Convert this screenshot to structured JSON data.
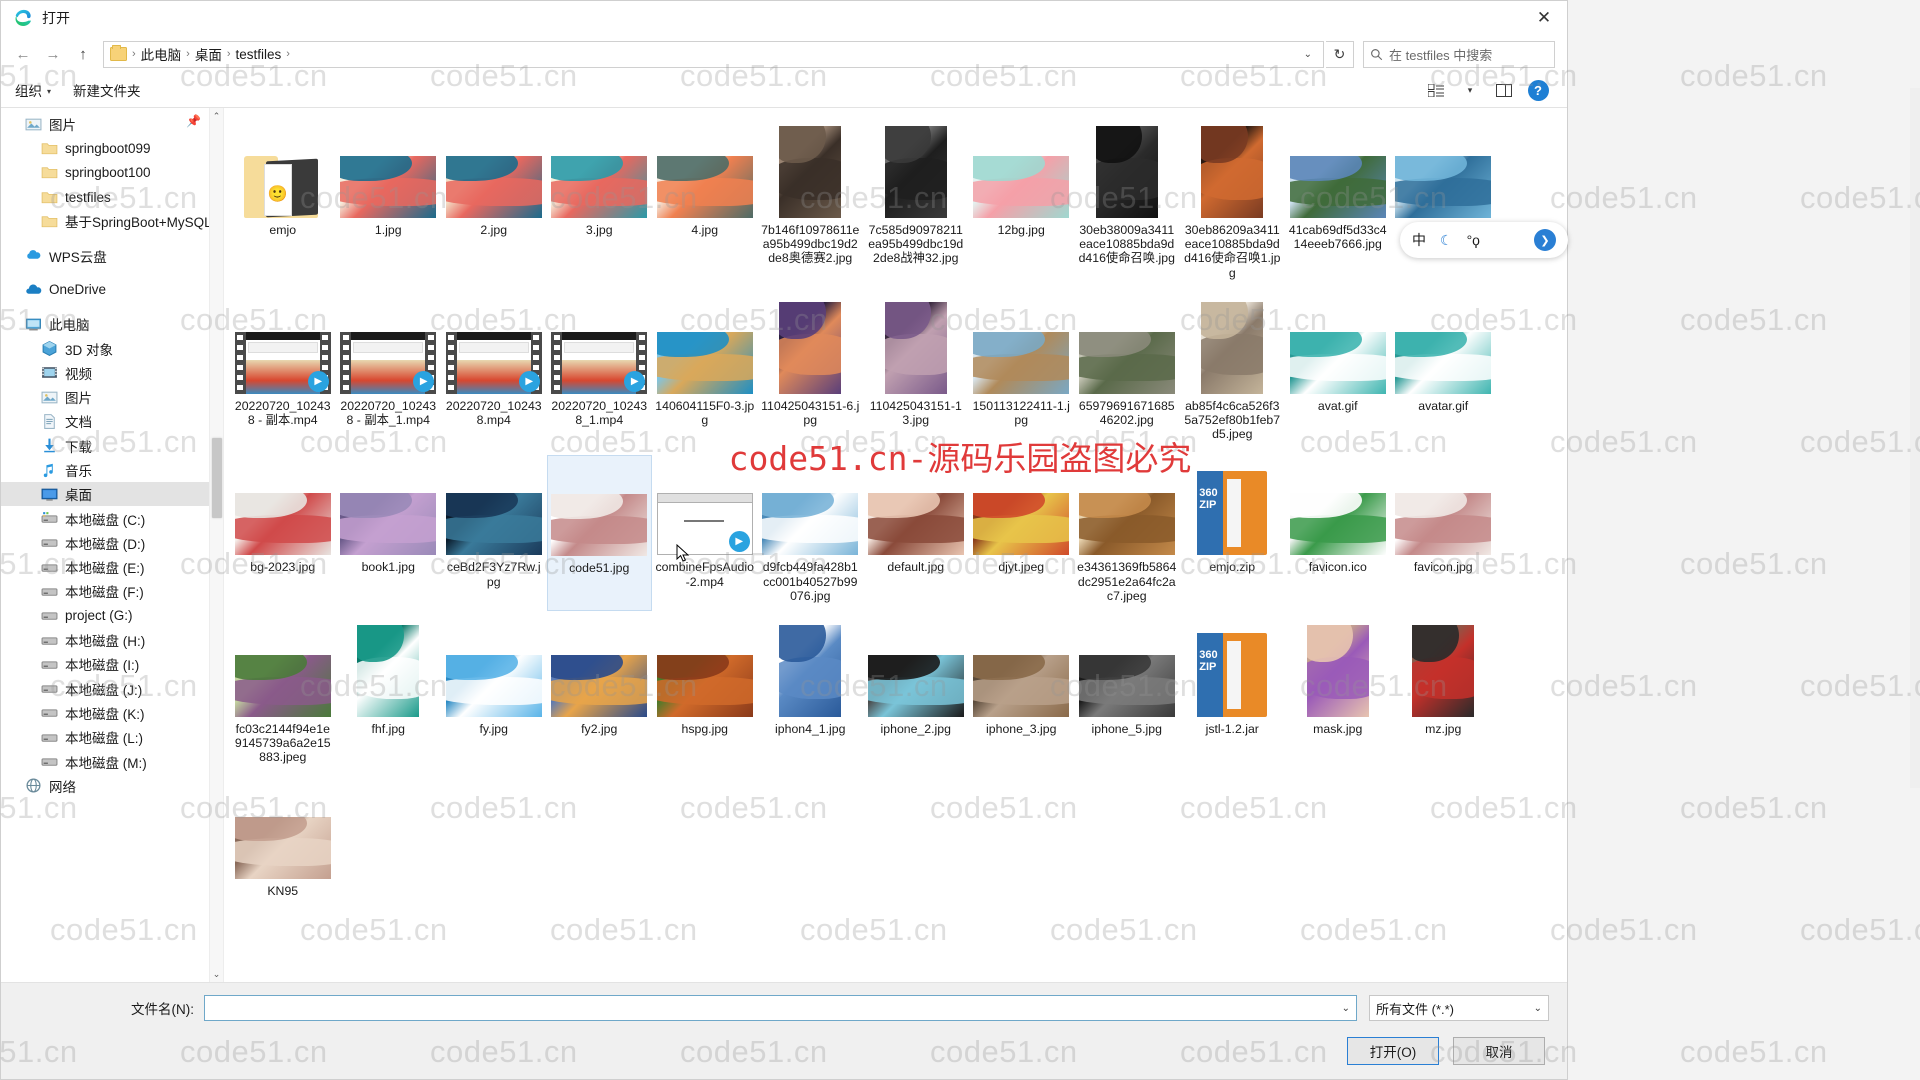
{
  "window": {
    "title": "打开",
    "app_icon": "edge-icon",
    "close_label": "✕"
  },
  "nav": {
    "back": "←",
    "forward": "→",
    "up": "↑",
    "refresh": "↻",
    "address_chevron": "⌄",
    "breadcrumbs": [
      "此电脑",
      "桌面",
      "testfiles"
    ],
    "separator": "›"
  },
  "search": {
    "placeholder": "在 testfiles 中搜索",
    "icon": "search-icon"
  },
  "command_bar": {
    "organize": "组织",
    "organize_caret": "▾",
    "new_folder": "新建文件夹",
    "view_icon": "view-list-icon",
    "view_caret": "▾",
    "pane_icon": "preview-pane-icon",
    "help_icon": "?"
  },
  "sidebar": {
    "pin_icon": "pin-icon",
    "scroll_up": "⌃",
    "scroll_down": "⌄",
    "items": [
      {
        "label": "图片",
        "icon": "pictures-icon",
        "indent": 0,
        "selected": false
      },
      {
        "label": "springboot099",
        "icon": "folder-icon",
        "indent": 1,
        "selected": false
      },
      {
        "label": "springboot100",
        "icon": "folder-icon",
        "indent": 1,
        "selected": false
      },
      {
        "label": "testfiles",
        "icon": "folder-icon",
        "indent": 1,
        "selected": false
      },
      {
        "label": "基于SpringBoot+MySQL+Vue",
        "icon": "folder-icon",
        "indent": 1,
        "selected": false
      },
      {
        "label": "WPS云盘",
        "icon": "cloud-icon",
        "indent": 0,
        "selected": false,
        "spacer_before": true
      },
      {
        "label": "OneDrive",
        "icon": "onedrive-icon",
        "indent": 0,
        "selected": false,
        "spacer_before": true
      },
      {
        "label": "此电脑",
        "icon": "pc-icon",
        "indent": 0,
        "selected": false,
        "spacer_before": true
      },
      {
        "label": "3D 对象",
        "icon": "3dobjects-icon",
        "indent": 1,
        "selected": false
      },
      {
        "label": "视频",
        "icon": "videos-icon",
        "indent": 1,
        "selected": false
      },
      {
        "label": "图片",
        "icon": "pictures-icon",
        "indent": 1,
        "selected": false
      },
      {
        "label": "文档",
        "icon": "documents-icon",
        "indent": 1,
        "selected": false
      },
      {
        "label": "下载",
        "icon": "downloads-icon",
        "indent": 1,
        "selected": false
      },
      {
        "label": "音乐",
        "icon": "music-icon",
        "indent": 1,
        "selected": false
      },
      {
        "label": "桌面",
        "icon": "desktop-icon",
        "indent": 1,
        "selected": true
      },
      {
        "label": "本地磁盘 (C:)",
        "icon": "drive-system-icon",
        "indent": 1,
        "selected": false
      },
      {
        "label": "本地磁盘 (D:)",
        "icon": "drive-icon",
        "indent": 1,
        "selected": false
      },
      {
        "label": "本地磁盘 (E:)",
        "icon": "drive-icon",
        "indent": 1,
        "selected": false
      },
      {
        "label": "本地磁盘 (F:)",
        "icon": "drive-icon",
        "indent": 1,
        "selected": false
      },
      {
        "label": "project (G:)",
        "icon": "drive-icon",
        "indent": 1,
        "selected": false
      },
      {
        "label": "本地磁盘 (H:)",
        "icon": "drive-icon",
        "indent": 1,
        "selected": false
      },
      {
        "label": "本地磁盘 (I:)",
        "icon": "drive-icon",
        "indent": 1,
        "selected": false
      },
      {
        "label": "本地磁盘 (J:)",
        "icon": "drive-icon",
        "indent": 1,
        "selected": false
      },
      {
        "label": "本地磁盘 (K:)",
        "icon": "drive-icon",
        "indent": 1,
        "selected": false
      },
      {
        "label": "本地磁盘 (L:)",
        "icon": "drive-icon",
        "indent": 1,
        "selected": false
      },
      {
        "label": "本地磁盘 (M:)",
        "icon": "drive-icon",
        "indent": 1,
        "selected": false
      },
      {
        "label": "网络",
        "icon": "network-icon",
        "indent": 0,
        "selected": false
      }
    ]
  },
  "files": [
    {
      "name": "emjo",
      "kind": "folder",
      "selected": false
    },
    {
      "name": "1.jpg",
      "kind": "image",
      "c1": "#1b6b8c",
      "c2": "#e8685f",
      "c3": "#f6eede",
      "selected": false
    },
    {
      "name": "2.jpg",
      "kind": "image",
      "c1": "#1b6b8c",
      "c2": "#e8685f",
      "c3": "#f3dcc4",
      "selected": false
    },
    {
      "name": "3.jpg",
      "kind": "image",
      "c1": "#2a9aa8",
      "c2": "#e8685f",
      "c3": "#f7f0dc",
      "selected": false
    },
    {
      "name": "4.jpg",
      "kind": "image",
      "c1": "#4d6b66",
      "c2": "#f08050",
      "c3": "#f5e9dd",
      "selected": false
    },
    {
      "name": "7b146f10978611ea95b499dbc19d2de8奥德赛2.jpg",
      "kind": "image",
      "c1": "#6b5a4a",
      "c2": "#3a2f28",
      "c3": "#9a8472",
      "selected": false,
      "tall": true
    },
    {
      "name": "7c585d90978211ea95b499dbc19d2de8战神32.jpg",
      "kind": "image",
      "c1": "#3a3a3a",
      "c2": "#1e1e1e",
      "c3": "#6e6e6e",
      "selected": false,
      "tall": true
    },
    {
      "name": "12bg.jpg",
      "kind": "image",
      "c1": "#9fd8d0",
      "c2": "#f5a0a8",
      "c3": "#e4f3f1",
      "selected": false
    },
    {
      "name": "30eb38009a3411eace10885bda9dd416使命召唤.jpg",
      "kind": "image",
      "c1": "#111111",
      "c2": "#2b2b2b",
      "c3": "#4a4a4a",
      "selected": false,
      "tall": true
    },
    {
      "name": "30eb86209a3411eace10885bda9dd416使命召唤1.jpg",
      "kind": "image",
      "c1": "#7a3b22",
      "c2": "#d06a30",
      "c3": "#2a1a12",
      "selected": false,
      "tall": true
    },
    {
      "name": "41cab69df5d33c414eeeb7666.jpg",
      "kind": "image",
      "c1": "#5b86b8",
      "c2": "#3f6b3a",
      "c3": "#cfe2f2",
      "selected": false
    },
    {
      "name": "",
      "kind": "image",
      "c1": "#6fb4d8",
      "c2": "#2f6f9a",
      "c3": "#cfe6f2",
      "selected": false,
      "partial": true
    },
    {
      "name": "20220720_102438 - 副本.mp4",
      "kind": "video",
      "selected": false
    },
    {
      "name": "20220720_102438 - 副本_1.mp4",
      "kind": "video",
      "selected": false
    },
    {
      "name": "20220720_102438.mp4",
      "kind": "video",
      "selected": false
    },
    {
      "name": "20220720_102438_1.mp4",
      "kind": "video",
      "selected": false
    },
    {
      "name": "140604115F0-3.jpg",
      "kind": "image",
      "c1": "#1e8fc4",
      "c2": "#d9a85a",
      "c3": "#7fc4e2",
      "selected": false
    },
    {
      "name": "110425043151-6.jpg",
      "kind": "image",
      "c1": "#5a3f7a",
      "c2": "#e08a5a",
      "c3": "#2a2040",
      "selected": false,
      "tall": true
    },
    {
      "name": "110425043151-13.jpg",
      "kind": "image",
      "c1": "#7a5a8a",
      "c2": "#c0a0b0",
      "c3": "#3a2a40",
      "selected": false,
      "tall": true
    },
    {
      "name": "150113122411-1.jpg",
      "kind": "image",
      "c1": "#7aa8c4",
      "c2": "#b08a5a",
      "c3": "#d9e6ee",
      "selected": false
    },
    {
      "name": "6597969167168546202.jpg",
      "kind": "image",
      "c1": "#8a8a7a",
      "c2": "#5a6a4a",
      "c3": "#c4c4b4",
      "selected": false
    },
    {
      "name": "ab85f4c6ca526f35a752ef80b1feb7d5.jpeg",
      "kind": "image",
      "c1": "#c4b49a",
      "c2": "#8a7a6a",
      "c3": "#e8e0d4",
      "selected": false,
      "tall": true
    },
    {
      "name": "avat.gif",
      "kind": "image",
      "c1": "#3fb5b0",
      "c2": "#ffffff",
      "c3": "#2a9a96",
      "selected": false
    },
    {
      "name": "avatar.gif",
      "kind": "image",
      "c1": "#3fb5b0",
      "c2": "#ffffff",
      "c3": "#2a9a96",
      "selected": false
    },
    {
      "name": "bg-2023.jpg",
      "kind": "image",
      "c1": "#e8e4e0",
      "c2": "#d04a4a",
      "c3": "#f5f2ee",
      "selected": false
    },
    {
      "name": "book1.jpg",
      "kind": "image",
      "c1": "#9a8ab8",
      "c2": "#c4a0d0",
      "c3": "#6a5a8a",
      "selected": false
    },
    {
      "name": "ceBd2F3Yz7Rw.jpg",
      "kind": "image",
      "c1": "#1a3a5a",
      "c2": "#3a7a9a",
      "c3": "#0a1a2a",
      "selected": false
    },
    {
      "name": "code51.jpg",
      "kind": "image",
      "c1": "#f0e8e4",
      "c2": "#c48a8a",
      "c3": "#ffffff",
      "selected": true
    },
    {
      "name": "combineFpsAudio-2.mp4",
      "kind": "app",
      "selected": false
    },
    {
      "name": "d9fcb449fa428b1cc001b40527b99076.jpg",
      "kind": "image",
      "c1": "#7ab4d8",
      "c2": "#ffffff",
      "c3": "#4a8ab8",
      "selected": false
    },
    {
      "name": "default.jpg",
      "kind": "image",
      "c1": "#e8c4b0",
      "c2": "#8a4a3a",
      "c3": "#f5e8e0",
      "selected": false
    },
    {
      "name": "djyt.jpeg",
      "kind": "image",
      "c1": "#d04a2a",
      "c2": "#e8c44a",
      "c3": "#8a3a1a",
      "selected": false
    },
    {
      "name": "e34361369fb5864dc2951e2a64fc2ac7.jpeg",
      "kind": "image",
      "c1": "#c48a4a",
      "c2": "#8a5a2a",
      "c3": "#e8d4b0",
      "selected": false
    },
    {
      "name": "emjo.zip",
      "kind": "zip",
      "selected": false
    },
    {
      "name": "favicon.ico",
      "kind": "image",
      "c1": "#ffffff",
      "c2": "#3a9a4a",
      "c3": "#f5f5f5",
      "selected": false
    },
    {
      "name": "favicon.jpg",
      "kind": "image",
      "c1": "#f0e8e4",
      "c2": "#c48a8a",
      "c3": "#ffffff",
      "selected": false
    },
    {
      "name": "fc03c2144f94e1e9145739a6a2e15883.jpeg",
      "kind": "image",
      "c1": "#4a7a3a",
      "c2": "#8a5a8a",
      "c3": "#c4d4a0",
      "selected": false
    },
    {
      "name": "fhf.jpg",
      "kind": "image",
      "c1": "#1a9a8a",
      "c2": "#ffffff",
      "c3": "#0a7a6a",
      "selected": false,
      "tall": true
    },
    {
      "name": "fy.jpg",
      "kind": "image",
      "c1": "#5ab4e8",
      "c2": "#ffffff",
      "c3": "#2a8ac4",
      "selected": false
    },
    {
      "name": "fy2.jpg",
      "kind": "image",
      "c1": "#2a4a8a",
      "c2": "#e8a44a",
      "c3": "#5a7ab4",
      "selected": false
    },
    {
      "name": "hspg.jpg",
      "kind": "image",
      "c1": "#8a3a1a",
      "c2": "#d06a2a",
      "c3": "#4a7a2a",
      "selected": false
    },
    {
      "name": "iphon4_1.jpg",
      "kind": "image",
      "c1": "#2a5a9a",
      "c2": "#5a8ac4",
      "c3": "#ffffff",
      "selected": false,
      "tall": true
    },
    {
      "name": "iphone_2.jpg",
      "kind": "image",
      "c1": "#1a1a1a",
      "c2": "#7ac4d8",
      "c3": "#4a4a4a",
      "selected": false
    },
    {
      "name": "iphone_3.jpg",
      "kind": "image",
      "c1": "#8a6a4a",
      "c2": "#b8a08a",
      "c3": "#5a4a3a",
      "selected": false
    },
    {
      "name": "iphone_5.jpg",
      "kind": "image",
      "c1": "#3a3a3a",
      "c2": "#7a7a7a",
      "c3": "#1a1a1a",
      "selected": false
    },
    {
      "name": "jstl-1.2.jar",
      "kind": "zip",
      "selected": false
    },
    {
      "name": "mask.jpg",
      "kind": "image",
      "c1": "#e8c4b0",
      "c2": "#9a5ab8",
      "c3": "#c4a090",
      "selected": false,
      "tall": true
    },
    {
      "name": "mz.jpg",
      "kind": "image",
      "c1": "#2a2a2a",
      "c2": "#c4302a",
      "c3": "#8a5a4a",
      "selected": false,
      "tall": true
    },
    {
      "name": "KN95",
      "kind": "image",
      "c1": "#c4a090",
      "c2": "#e8d4c4",
      "c3": "#8a6a5a",
      "selected": false,
      "partial": true
    }
  ],
  "footer": {
    "filename_label": "文件名(N):",
    "filename_value": "",
    "filename_chevron": "⌄",
    "filetype_value": "所有文件 (*.*)",
    "filetype_chevron": "⌄",
    "open_button": "打开(O)",
    "cancel_button": "取消"
  },
  "ime": {
    "mode": "中",
    "moon_icon": "moon-icon",
    "emoji_icon": "°ϙ",
    "next_icon": "❯"
  },
  "watermarks": {
    "tile_text": "code51.cn",
    "center_text": "code51.cn-源码乐园盗图必究",
    "center_color": "#e03a3a"
  }
}
